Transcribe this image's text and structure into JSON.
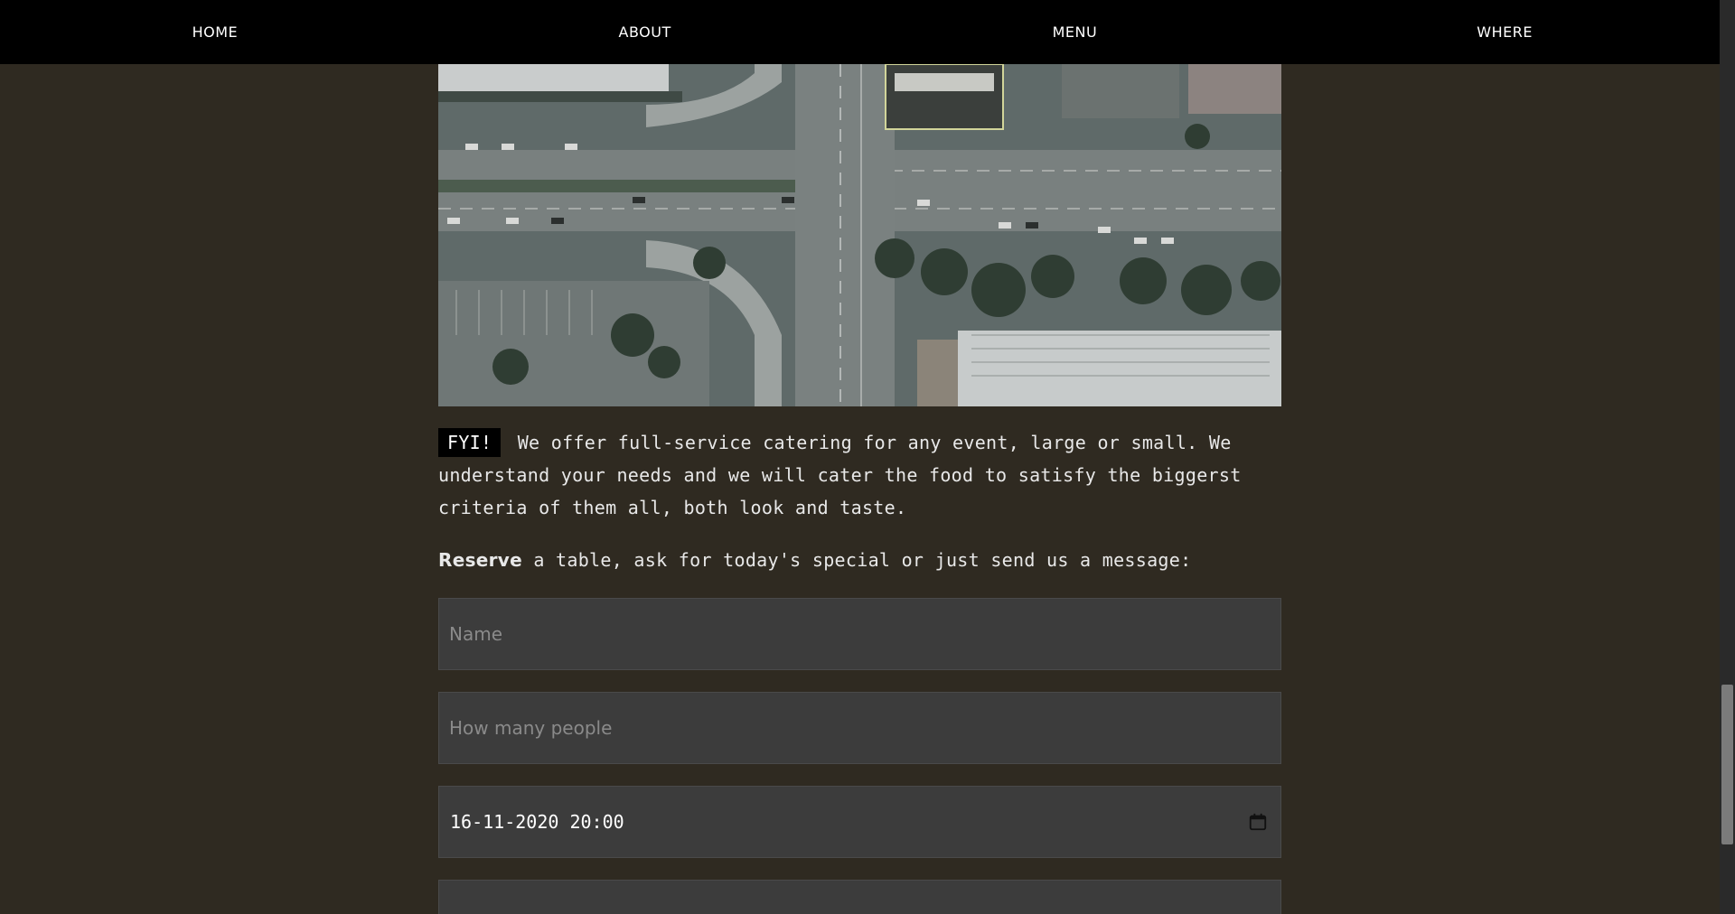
{
  "nav": {
    "items": [
      {
        "label": "HOME"
      },
      {
        "label": "ABOUT"
      },
      {
        "label": "MENU"
      },
      {
        "label": "WHERE"
      }
    ]
  },
  "intro": {
    "tag": "FYI!",
    "text": "We offer full-service catering for any event, large or small. We understand your needs and we will cater the food to satisfy the biggerst criteria of them all, both look and taste."
  },
  "reserve": {
    "bold": "Reserve",
    "text": " a table, ask for today's special or just send us a message:"
  },
  "form": {
    "name_placeholder": "Name",
    "people_placeholder": "How many people",
    "datetime_value": "16-11-2020 20:00",
    "datetime_icon": "calendar-icon"
  },
  "colors": {
    "background": "#2f2a21",
    "nav_background": "#000000",
    "field_background": "#3c3c3c"
  }
}
